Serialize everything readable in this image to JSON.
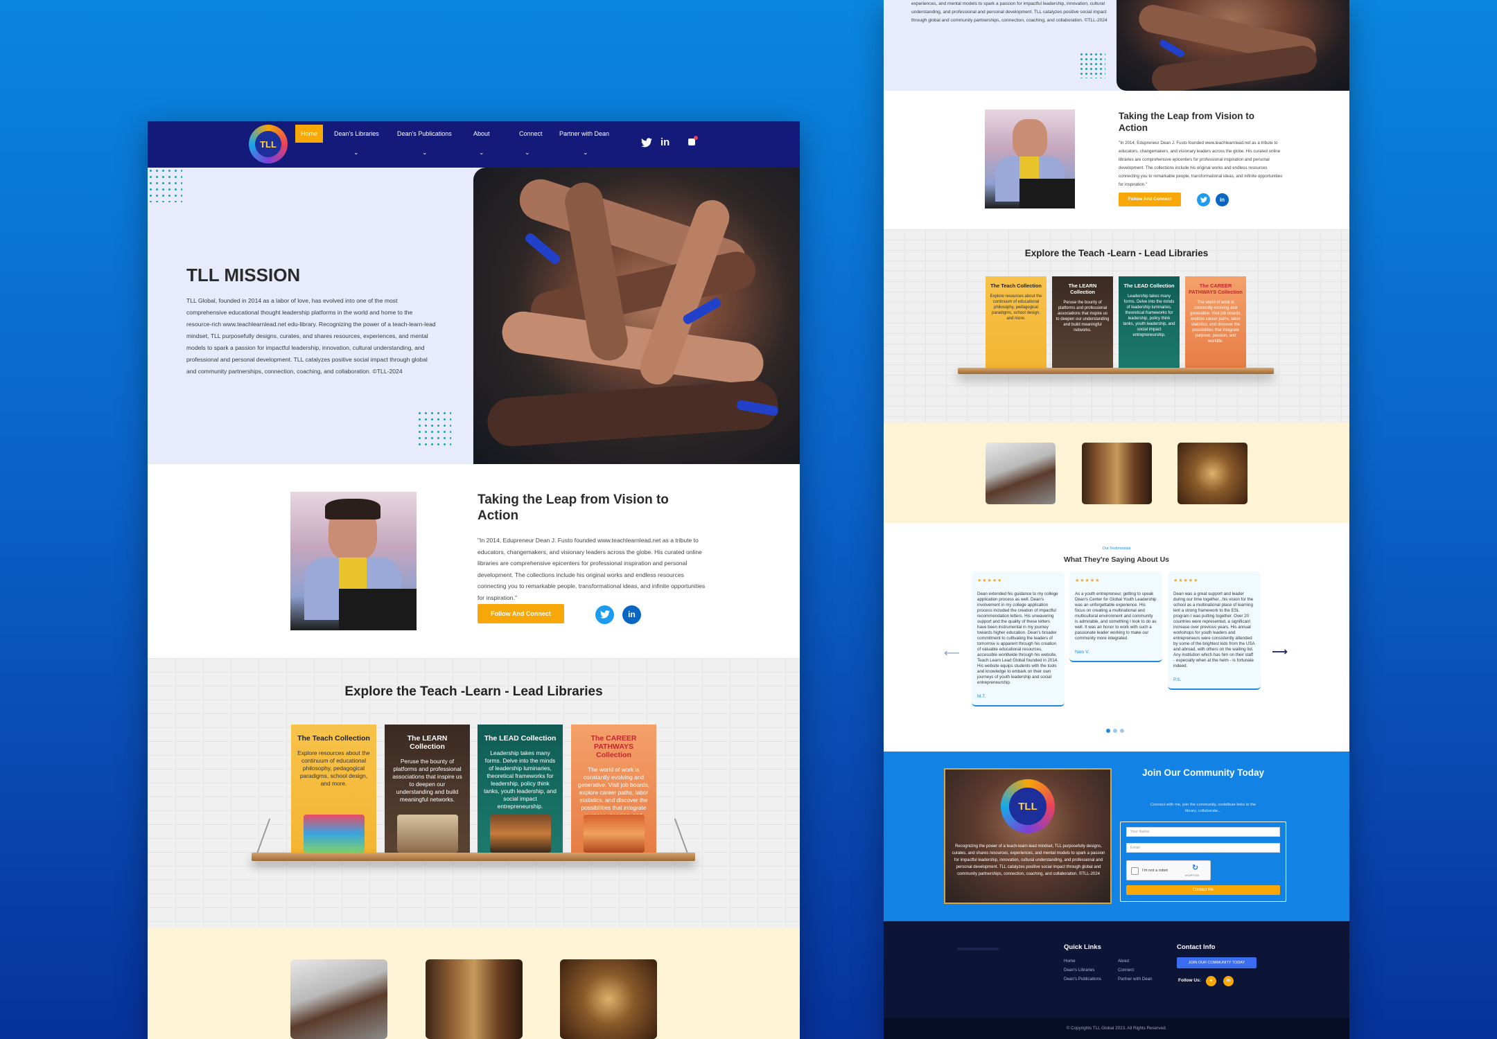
{
  "nav": {
    "logo_text": "TLL",
    "items": [
      {
        "label": "Home"
      },
      {
        "label": "Dean's Libraries"
      },
      {
        "label": "Dean's Publications"
      },
      {
        "label": "About"
      },
      {
        "label": "Connect"
      },
      {
        "label": "Partner with Dean"
      }
    ],
    "social_twitter": "twitter-icon",
    "social_linkedin": "in",
    "cart_icon": "cart-icon"
  },
  "mission": {
    "title": "TLL MISSION",
    "text": "TLL Global, founded in 2014 as a labor of love, has evolved into one of the most comprehensive educational thought leadership platforms in the world and home to the resource-rich www.teachlearnlead.net edu-library. Recognizing the power of a teach-learn-lead mindset, TLL purposefully designs, curates, and shares resources, experiences, and mental models to spark a passion for impactful leadership, innovation, cultural understanding, and professional and personal development. TLL catalyzes positive social impact through global and community partnerships, connection, coaching, and collaboration. ©TLL-2024"
  },
  "leap": {
    "title": "Taking the Leap from Vision to Action",
    "text": "\"In 2014, Edupreneur Dean J. Fusto founded www.teachlearnlead.net as a tribute to educators, changemakers, and visionary leaders across the globe. His curated online libraries are comprehensive epicenters for professional inspiration and personal development. The collections include his original works and endless resources connecting you to remarkable people, transformational ideas, and infinite opportunities for inspiration.\"",
    "button": "Follow And Connect",
    "linkedin": "in"
  },
  "libraries": {
    "title": "Explore the Teach -Learn - Lead Libraries",
    "books": [
      {
        "title": "The Teach Collection",
        "desc": "Explore resources about the continuum of educational philosophy, pedagogical paradigms, school design, and more."
      },
      {
        "title": "The LEARN Collection",
        "desc": "Peruse the bounty of platforms and professional associations that inspire us to deepen our understanding and build meaningful networks."
      },
      {
        "title": "The LEAD Collection",
        "desc": "Leadership takes many forms. Delve into the minds of leadership luminaries, theoretical frameworks for leadership, policy think tanks, youth leadership, and social impact entrepreneurship."
      },
      {
        "title": "The CAREER PATHWAYS Collection",
        "desc": "The world of work is constantly evolving and generative. Visit job boards, explore career paths, labor statistics, and discover the possibilities that integrate purpose, passion, and worklife."
      }
    ]
  },
  "right_mission_fragment": "experiences, and mental models to spark a passion for impactful leadership, innovation, cultural understanding, and professional and personal development. TLL catalyzes positive social impact through global and community partnerships, connection, coaching, and collaboration. ©TLL-2024",
  "testimonials": {
    "kicker": "Our Testimonials",
    "title": "What They're Saying About Us",
    "cards": [
      {
        "stars": "★★★★★",
        "text": "Dean extended his guidance to my college application process as well. Dean's involvement in my college application process included the creation of impactful recommendation letters. His unwavering support and the quality of these letters have been instrumental in my journey towards higher education. Dean's broader commitment to cultivating the leaders of tomorrow is apparent through his creation of valuable educational resources, accessible worldwide through his website, Teach Learn Lead Global founded in 2014. His website equips students with the tools and knowledge to embark on their own journeys of youth leadership and social entrepreneurship.",
        "author": "M.T."
      },
      {
        "stars": "★★★★★",
        "text": "As a youth entrepreneur, getting to speak Dean's Center for Global Youth Leadership was an unforgettable experience. His focus on creating a multinational and multicultural environment and community is admirable, and something I look to do as well. It was an honor to work with such a passionate leader working to make our community more integrated.",
        "author": "Nelo V."
      },
      {
        "stars": "★★★★★",
        "text": "Dean was a great support and leader during our time together...his vision for the school as a multinational place of learning lent a strong framework to the ESL program I was putting together. Over 20 countries were represented, a significant increase over previous years. His annual workshops for youth leaders and entrepreneurs were consistently attended by some of the brightest kids from the USA and abroad, with others on the waiting list. Any institution which has him on their staff - especially when at the helm - is fortunate indeed.",
        "author": "P.S."
      }
    ]
  },
  "join": {
    "title": "Join Our Community Today",
    "subtitle": "Connect with me, join the community, contribute links to the library, collaborate...",
    "photo_text": "Recognizing the power of a teach-learn-lead mindset, TLL purposefully designs, curates, and shares resources, experiences, and mental models to spark a passion for impactful leadership, innovation, cultural understanding, and professional and personal development. TLL catalyzes positive social impact through global and community partnerships, connection, coaching, and collaboration. ©TLL-2024",
    "name_placeholder": "Your Name",
    "email_placeholder": "Email",
    "captcha_label": "I'm not a robot",
    "captcha_brand": "reCAPTCHA",
    "button": "Contact Me"
  },
  "footer": {
    "quick_links_title": "Quick Links",
    "links_col1": [
      "Home",
      "Dean's Libraries",
      "Dean's Publications"
    ],
    "links_col2": [
      "About",
      "Connect",
      "Partner with Dean"
    ],
    "contact_title": "Contact Info",
    "join_button": "JOIN OUR COMMUNITY TODAY",
    "follow_label": "Follow Us:",
    "copyright": "© Copyrights TLL Global 2023. All Rights Reserved."
  },
  "colors": {
    "nav": "#131a7a",
    "accent": "#f7a707",
    "brand_blue": "#1282e4"
  }
}
